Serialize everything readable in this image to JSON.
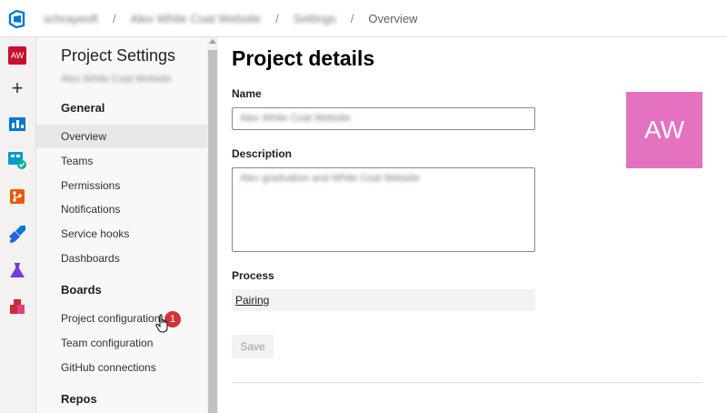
{
  "breadcrumb": {
    "org": "schrayeoft",
    "project": "Alex White Coat Website",
    "settings": "Settings",
    "current": "Overview",
    "separator": "/"
  },
  "rail": {
    "avatar_initials": "AW",
    "add_icon": "+"
  },
  "sidebar": {
    "title": "Project Settings",
    "subtitle": "Alex White Coat Website",
    "sections": {
      "general": "General",
      "boards": "Boards",
      "repos": "Repos"
    },
    "general_items": [
      "Overview",
      "Teams",
      "Permissions",
      "Notifications",
      "Service hooks",
      "Dashboards"
    ],
    "boards_items": [
      "Project configuration",
      "Team configuration",
      "GitHub connections"
    ],
    "badge_count": "1"
  },
  "main": {
    "title": "Project details",
    "name_label": "Name",
    "name_value": "Alex White Coat Website",
    "description_label": "Description",
    "description_value": "Alex graduation and White Coat Website",
    "process_label": "Process",
    "process_value": "Pairing",
    "save_label": "Save",
    "avatar_initials": "AW"
  },
  "colors": {
    "project_avatar": "#e571c1",
    "rail_avatar": "#c8102e",
    "badge": "#d13438"
  }
}
